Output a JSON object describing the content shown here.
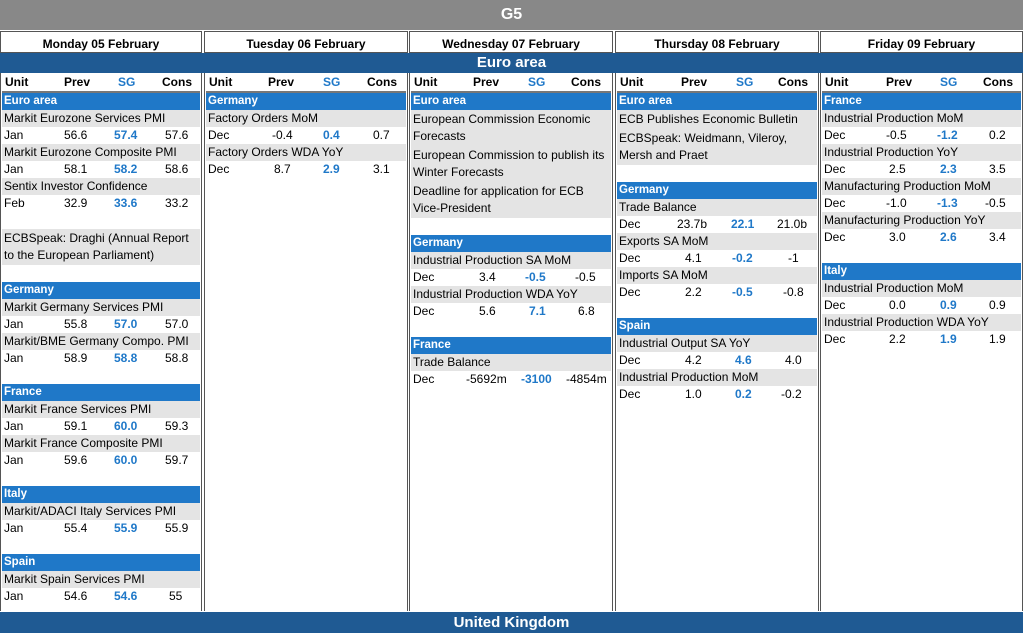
{
  "title": "G5",
  "regions": {
    "euro": "Euro area",
    "uk": "United Kingdom"
  },
  "colhead": {
    "unit": "Unit",
    "prev": "Prev",
    "sg": "SG",
    "cons": "Cons"
  },
  "days": [
    {
      "label": "Monday 05 February"
    },
    {
      "label": "Tuesday 06 February"
    },
    {
      "label": "Wednesday 07 February"
    },
    {
      "label": "Thursday 08 February"
    },
    {
      "label": "Friday 09 February"
    }
  ],
  "mon": {
    "cat_euro": "Euro area",
    "i1": {
      "name": "Markit Eurozone Services PMI",
      "unit": "Jan",
      "prev": "56.6",
      "sg": "57.4",
      "cons": "57.6"
    },
    "i2": {
      "name": "Markit Eurozone Composite PMI",
      "unit": "Jan",
      "prev": "58.1",
      "sg": "58.2",
      "cons": "58.6"
    },
    "i3": {
      "name": "Sentix Investor Confidence",
      "unit": "Feb",
      "prev": "32.9",
      "sg": "33.6",
      "cons": "33.2"
    },
    "ev1": "ECBSpeak: Draghi (Annual Report to the European Parliament)",
    "cat_de": "Germany",
    "i4": {
      "name": "Markit Germany Services PMI",
      "unit": "Jan",
      "prev": "55.8",
      "sg": "57.0",
      "cons": "57.0"
    },
    "i5": {
      "name": "Markit/BME Germany Compo. PMI",
      "unit": "Jan",
      "prev": "58.9",
      "sg": "58.8",
      "cons": "58.8"
    },
    "cat_fr": "France",
    "i6": {
      "name": "Markit France Services PMI",
      "unit": "Jan",
      "prev": "59.1",
      "sg": "60.0",
      "cons": "59.3"
    },
    "i7": {
      "name": "Markit France Composite PMI",
      "unit": "Jan",
      "prev": "59.6",
      "sg": "60.0",
      "cons": "59.7"
    },
    "cat_it": "Italy",
    "i8": {
      "name": "Markit/ADACI Italy Services PMI",
      "unit": "Jan",
      "prev": "55.4",
      "sg": "55.9",
      "cons": "55.9"
    },
    "cat_es": "Spain",
    "i9": {
      "name": "Markit Spain Services PMI",
      "unit": "Jan",
      "prev": "54.6",
      "sg": "54.6",
      "cons": "55"
    }
  },
  "tue": {
    "cat_de": "Germany",
    "i1": {
      "name": "Factory Orders MoM",
      "unit": "Dec",
      "prev": "-0.4",
      "sg": "0.4",
      "cons": "0.7"
    },
    "i2": {
      "name": "Factory Orders WDA YoY",
      "unit": "Dec",
      "prev": "8.7",
      "sg": "2.9",
      "cons": "3.1"
    }
  },
  "wed": {
    "cat_euro": "Euro area",
    "ev1": "European Commission Economic Forecasts",
    "ev2": "European Commission to publish its Winter Forecasts",
    "ev3": "Deadline for application for ECB Vice-President",
    "cat_de": "Germany",
    "i1": {
      "name": "Industrial Production SA MoM",
      "unit": "Dec",
      "prev": "3.4",
      "sg": "-0.5",
      "cons": "-0.5"
    },
    "i2": {
      "name": "Industrial Production WDA YoY",
      "unit": "Dec",
      "prev": "5.6",
      "sg": "7.1",
      "cons": "6.8"
    },
    "cat_fr": "France",
    "i3": {
      "name": "Trade Balance",
      "unit": "Dec",
      "prev": "-5692m",
      "sg": "-3100",
      "cons": "-4854m"
    }
  },
  "thu": {
    "cat_euro": "Euro area",
    "ev1": "ECB Publishes Economic Bulletin",
    "ev2": "ECBSpeak: Weidmann, Vileroy, Mersh and Praet",
    "cat_de": "Germany",
    "i1": {
      "name": "Trade Balance",
      "unit": "Dec",
      "prev": "23.7b",
      "sg": "22.1",
      "cons": "21.0b"
    },
    "i2": {
      "name": "Exports SA MoM",
      "unit": "Dec",
      "prev": "4.1",
      "sg": "-0.2",
      "cons": "-1"
    },
    "i3": {
      "name": "Imports SA MoM",
      "unit": "Dec",
      "prev": "2.2",
      "sg": "-0.5",
      "cons": "-0.8"
    },
    "cat_es": "Spain",
    "i4": {
      "name": "Industrial Output SA YoY",
      "unit": "Dec",
      "prev": "4.2",
      "sg": "4.6",
      "cons": "4.0"
    },
    "i5": {
      "name": "Industrial Production MoM",
      "unit": "Dec",
      "prev": "1.0",
      "sg": "0.2",
      "cons": "-0.2"
    }
  },
  "fri": {
    "cat_fr": "France",
    "i1": {
      "name": "Industrial Production MoM",
      "unit": "Dec",
      "prev": "-0.5",
      "sg": "-1.2",
      "cons": "0.2"
    },
    "i2": {
      "name": "Industrial Production YoY",
      "unit": "Dec",
      "prev": "2.5",
      "sg": "2.3",
      "cons": "3.5"
    },
    "i3": {
      "name": "Manufacturing Production MoM",
      "unit": "Dec",
      "prev": "-1.0",
      "sg": "-1.3",
      "cons": "-0.5"
    },
    "i4": {
      "name": "Manufacturing Production YoY",
      "unit": "Dec",
      "prev": "3.0",
      "sg": "2.6",
      "cons": "3.4"
    },
    "cat_it": "Italy",
    "i5": {
      "name": "Industrial Production MoM",
      "unit": "Dec",
      "prev": "0.0",
      "sg": "0.9",
      "cons": "0.9"
    },
    "i6": {
      "name": "Industrial Production WDA YoY",
      "unit": "Dec",
      "prev": "2.2",
      "sg": "1.9",
      "cons": "1.9"
    }
  },
  "colors": {
    "header_gray": "#888888",
    "region_blue": "#1f5a93",
    "category_blue": "#1f78c8",
    "row_gray": "#e4e4e4"
  }
}
